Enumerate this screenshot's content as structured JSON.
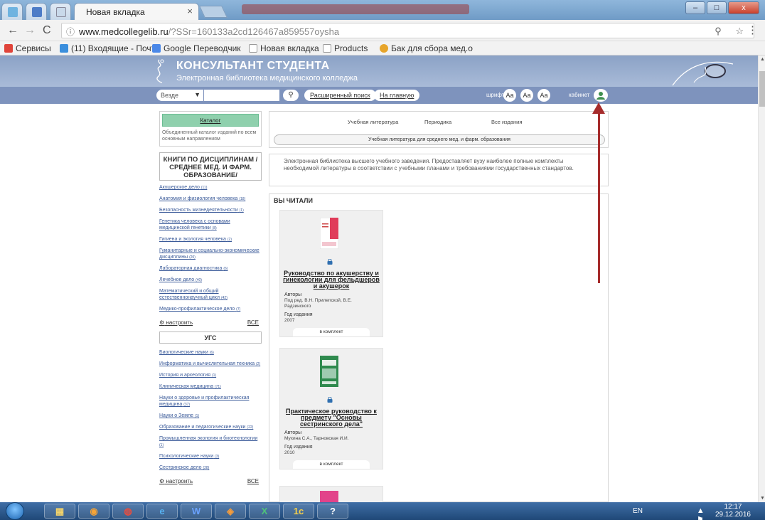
{
  "browser": {
    "active_tab_title": "Новая вкладка",
    "close_glyph": "×",
    "url_host": "www.medcollegelib.ru",
    "url_rest": "/?SSr=160133a2cd126467a859557oysha",
    "info_glyph": "ⓘ",
    "right_icons": "⚲ ☆",
    "menu_glyph": "⋮",
    "min_glyph": "–",
    "max_glyph": "□",
    "close_win_glyph": "x"
  },
  "bookmarks": [
    {
      "label": "Сервисы",
      "icon": "apps-icon",
      "color": "#e0443a"
    },
    {
      "label": "(11) Входящие - Почт",
      "icon": "mail-icon",
      "color": "#3b8fdd"
    },
    {
      "label": "Google Переводчик",
      "icon": "translate-icon",
      "color": "#4a88e8"
    },
    {
      "label": "Новая вкладка",
      "icon": "page-icon",
      "color": "#cccccc"
    },
    {
      "label": "Products",
      "icon": "page-icon",
      "color": "#cccccc"
    },
    {
      "label": "Бак для сбора мед.о",
      "icon": "folder-icon",
      "color": "#e7a52b"
    }
  ],
  "site": {
    "title": "КОНСУЛЬТАНТ СТУДЕНТА",
    "subtitle": "Электронная библиотека медицинского колледжа",
    "search_scope": "Везде",
    "search_icon": "🔍",
    "advanced_search": "Расширенный поиск",
    "home_link": "На главную",
    "font_label": "шрифт",
    "font_buttons": [
      "Aa",
      "Aa",
      "Aa"
    ],
    "cabinet_label": "кабинет"
  },
  "sidebar": {
    "catalog_button": "Каталог",
    "catalog_desc": "Объединенный каталог изданий по всем основным направлениям",
    "disciplines_title": "КНИГИ ПО ДИСЦИПЛИНАМ /СРЕДНЕЕ МЕД. И ФАРМ. ОБРАЗОВАНИЕ/",
    "disciplines": [
      {
        "name": "Акушерское дело",
        "count": "(11)"
      },
      {
        "name": "Анатомия и физиология человека",
        "count": "(18)"
      },
      {
        "name": "Безопасность жизнедеятельности",
        "count": "(1)"
      },
      {
        "name": "Генетика человека с основами медицинской генетики",
        "count": "(8)"
      },
      {
        "name": "Гигиена и экология человека",
        "count": "(2)"
      },
      {
        "name": "Гуманитарные и социально-экономические дисциплины",
        "count": "(20)"
      },
      {
        "name": "Лабораторная диагностика",
        "count": "(6)"
      },
      {
        "name": "Лечебное дело",
        "count": "(40)"
      },
      {
        "name": "Математический и общий естественнонаучный цикл",
        "count": "(42)"
      },
      {
        "name": "Медико-профилактическое дело",
        "count": "(7)"
      }
    ],
    "configure": "настроить",
    "all": "ВСЕ",
    "ugs_title": "УГС",
    "ugs": [
      {
        "name": "Биологические науки",
        "count": "(6)"
      },
      {
        "name": "Информатика и вычислительная техника",
        "count": "(2)"
      },
      {
        "name": "История и археология",
        "count": "(1)"
      },
      {
        "name": "Клиническая медицина",
        "count": "(71)"
      },
      {
        "name": "Науки о здоровье и профилактическая медицина",
        "count": "(37)"
      },
      {
        "name": "Науки о Земле",
        "count": "(1)"
      },
      {
        "name": "Образование и педагогические науки",
        "count": "(22)"
      },
      {
        "name": "Промышленная экология и биотехнологии",
        "count": "(1)"
      },
      {
        "name": "Психологические науки",
        "count": "(3)"
      },
      {
        "name": "Сестринское дело",
        "count": "(28)"
      }
    ],
    "configure2": "настроить",
    "all2": "ВСЕ"
  },
  "main": {
    "tabs": [
      "Учебная литература",
      "Периодика",
      "Все издания"
    ],
    "active_pill": "Учебная литература для среднего мед. и фарм. образования",
    "description": "Электронная библиотека высшего учебного заведения. Предоставляет вузу наиболее полные комплекты необходимой литературы в соответствии с учебными планами и требованиями государственных стандартов.",
    "read_title": "ВЫ ЧИТАЛИ",
    "books": [
      {
        "title": "Руководство по акушерству и гинекологии для фельдшеров и акушерок",
        "authors_label": "Авторы",
        "authors": "Под ред. В.Н. Прилепской, В.Е. Радзинского",
        "year_label": "Год издания",
        "year": "2007",
        "kit": "в комплект",
        "cover_color": "#e03c5a"
      },
      {
        "title": "Практическое руководство к предмету \"Основы сестринского дела\"",
        "authors_label": "Авторы",
        "authors": "Мухина С.А., Тарновская И.И.",
        "year_label": "Год издания",
        "year": "2010",
        "kit": "в комплект",
        "cover_color": "#2f8a4e"
      }
    ]
  },
  "taskbar": {
    "lang": "EN",
    "tray_icons": "▲ ⚑ ⊞ ◀)",
    "time": "12:17",
    "date": "29.12.2016",
    "apps": [
      "explorer-icon",
      "media-icon",
      "chrome-icon",
      "ie-icon",
      "word-icon",
      "paint-icon",
      "excel-icon",
      "1c-icon",
      "help-icon"
    ]
  },
  "colors": {
    "header": "#8ba2c6",
    "searchbar": "#7e93bd",
    "catalog_green": "#8fd0ad",
    "arrow": "#a62c2c",
    "link": "#3a5a99"
  }
}
